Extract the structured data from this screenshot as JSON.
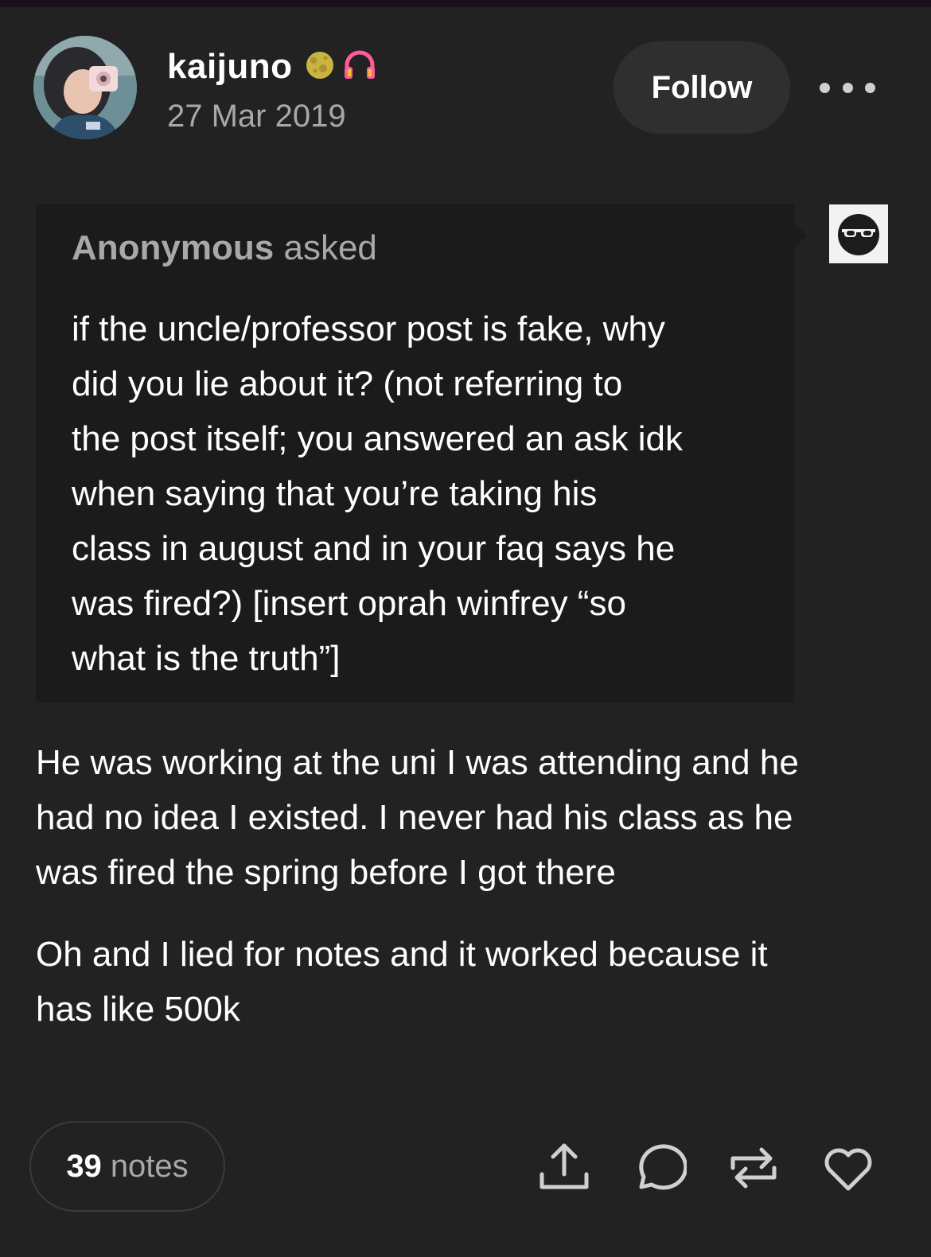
{
  "post": {
    "username": "kaijuno",
    "date": "27 Mar 2019",
    "badges": [
      "moon-badge-icon",
      "headphones-badge-icon"
    ],
    "follow_label": "Follow",
    "more_icon": "ellipsis-icon"
  },
  "ask": {
    "asker": "Anonymous",
    "asked_label": "asked",
    "lines": [
      "if the uncle/professor post is fake, why",
      "did you lie about it? (not referring to",
      "the post itself; you answered an ask idk",
      "when saying that you’re taking his",
      "class in august and in your faq says he",
      "was fired?) [insert oprah winfrey “so",
      "what is the truth”]"
    ],
    "anon_avatar_icon": "sunglasses-face-icon"
  },
  "answer": {
    "paragraph1_lines": [
      "He was working at the uni I was attending and he",
      "had no idea I existed. I never had his class as he",
      "was fired the spring before I got there"
    ],
    "paragraph2_lines": [
      "Oh and I lied for notes and it worked because it",
      "has like 500k"
    ]
  },
  "footer": {
    "notes_count": "39",
    "notes_label": "notes",
    "actions": [
      "share-icon",
      "reply-icon",
      "reblog-icon",
      "like-icon"
    ]
  },
  "colors": {
    "background": "#222223",
    "ask_background": "#1b1b1b",
    "secondary_text": "#a8a8a8",
    "button_background": "#2f2f30",
    "headphones": "#ff5a9a"
  }
}
